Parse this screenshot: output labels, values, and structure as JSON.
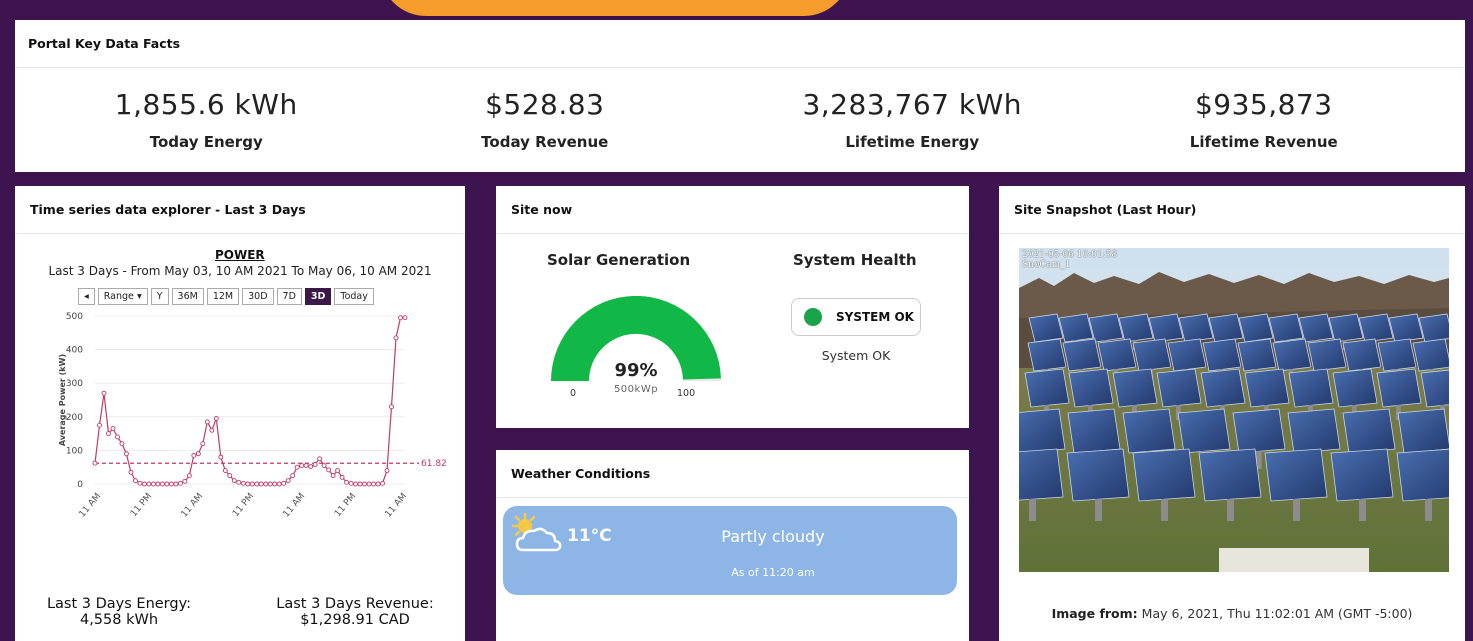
{
  "kpi": {
    "title": "Portal Key Data Facts",
    "items": [
      {
        "value": "1,855.6 kWh",
        "label": "Today Energy"
      },
      {
        "value": "$528.83",
        "label": "Today Revenue"
      },
      {
        "value": "3,283,767 kWh",
        "label": "Lifetime Energy"
      },
      {
        "value": "$935,873",
        "label": "Lifetime Revenue"
      }
    ]
  },
  "timeseries": {
    "title": "Time series data explorer - Last 3 Days",
    "chart_title": "POWER",
    "chart_subtitle": "Last 3 Days - From May 03, 10 AM 2021 To May 06, 10 AM 2021",
    "range_buttons": [
      "Range",
      "Y",
      "36M",
      "12M",
      "30D",
      "7D",
      "3D",
      "Today"
    ],
    "active_range": "3D",
    "summary": {
      "energy_label": "Last 3 Days Energy:",
      "energy_value": "4,558 kWh",
      "revenue_label": "Last 3 Days Revenue:",
      "revenue_value": "$1,298.91 CAD"
    }
  },
  "chart_data": {
    "type": "line",
    "title": "POWER",
    "subtitle": "Last 3 Days - From May 03, 10 AM 2021 To May 06, 10 AM 2021",
    "ylabel": "Average Power (kW)",
    "ylim": [
      0,
      500
    ],
    "yticks": [
      0,
      100,
      200,
      300,
      400,
      500
    ],
    "xticks": [
      "11 AM",
      "11 PM",
      "11 AM",
      "11 PM",
      "11 AM",
      "11 PM",
      "11 AM"
    ],
    "average_line": 61.82,
    "average_label": "61.82",
    "line_color": "#c03a6a",
    "series": [
      {
        "values": [
          62,
          175,
          270,
          150,
          165,
          140,
          120,
          90,
          35,
          10,
          2,
          0,
          0,
          0,
          0,
          0,
          0,
          0,
          0,
          2,
          8,
          25,
          85,
          90,
          120,
          185,
          160,
          195,
          80,
          40,
          25,
          10,
          5,
          2,
          0,
          0,
          0,
          0,
          0,
          0,
          0,
          0,
          2,
          10,
          25,
          50,
          55,
          55,
          52,
          58,
          75,
          55,
          42,
          25,
          40,
          20,
          5,
          2,
          0,
          0,
          0,
          0,
          0,
          0,
          2,
          40,
          230,
          435,
          495,
          495
        ]
      }
    ]
  },
  "site_now": {
    "title": "Site now",
    "solar_title": "Solar Generation",
    "gauge_value": 99,
    "gauge_percent": "99%",
    "gauge_unit": "500kWp",
    "gauge_min": "0",
    "gauge_max": "100",
    "gauge_color": "#12b847",
    "health_title": "System Health",
    "health_badge": "SYSTEM OK",
    "health_status": "System OK"
  },
  "weather": {
    "title": "Weather Conditions",
    "temp": "11°C",
    "condition": "Partly cloudy",
    "as_of": "As of 11:20 am",
    "icon": "partly-cloudy-icon"
  },
  "snapshot": {
    "title": "Site Snapshot (Last Hour)",
    "cam_time": "2021-05-06 10:01:58",
    "cam_name": "SnoCam_1",
    "image_from_label": "Image from:",
    "image_from_value": "May 6, 2021, Thu 11:02:01 AM (GMT -5:00)"
  }
}
